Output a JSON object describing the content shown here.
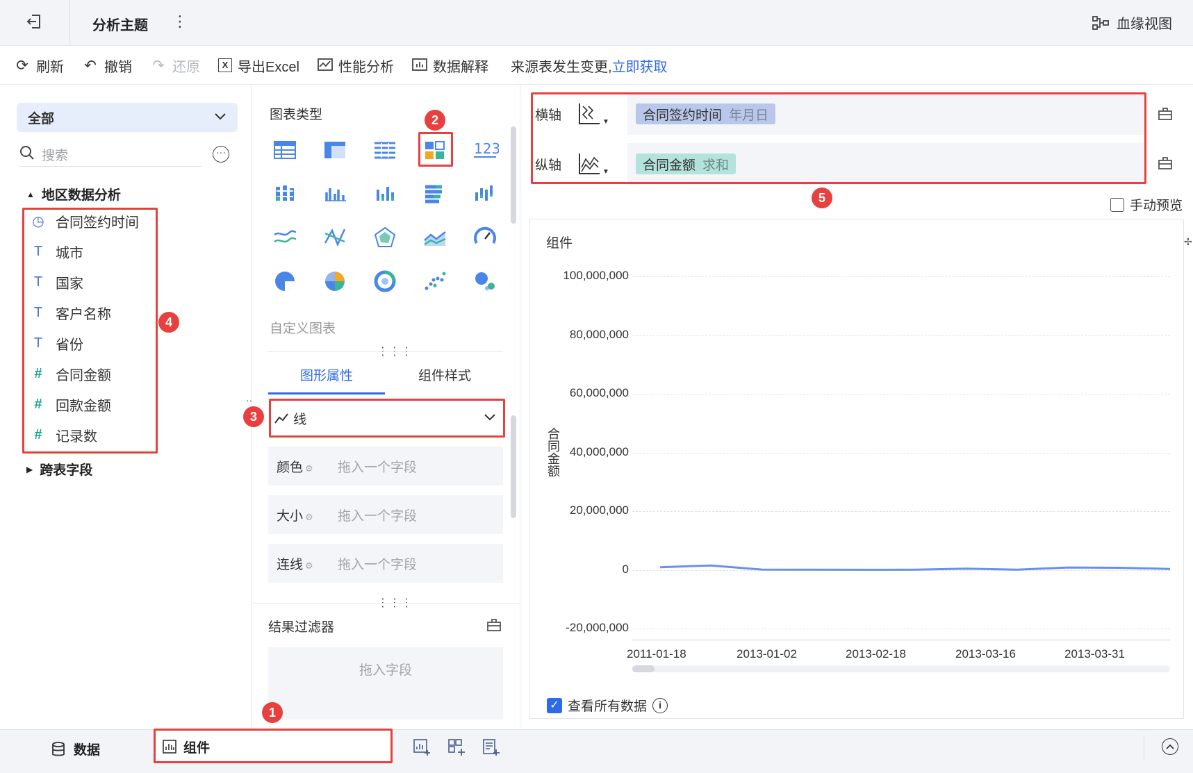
{
  "topbar": {
    "title": "分析主题",
    "lineage_label": "血缘视图"
  },
  "toolbar": {
    "refresh": "刷新",
    "undo": "撤销",
    "redo": "还原",
    "export_excel": "导出Excel",
    "perf_analysis": "性能分析",
    "data_explain": "数据解释",
    "notice_text": "来源表发生变更,",
    "notice_link": "立即获取"
  },
  "left": {
    "dropdown_value": "全部",
    "search_placeholder": "搜索",
    "group_label": "地区数据分析",
    "fields": [
      {
        "label": "合同签约时间",
        "icon": "clock-icon"
      },
      {
        "label": "城市",
        "icon": "text-icon"
      },
      {
        "label": "国家",
        "icon": "text-icon"
      },
      {
        "label": "客户名称",
        "icon": "text-icon"
      },
      {
        "label": "省份",
        "icon": "text-icon"
      },
      {
        "label": "合同金额",
        "icon": "hash-icon"
      },
      {
        "label": "回款金额",
        "icon": "hash-icon"
      },
      {
        "label": "记录数",
        "icon": "hash-icon"
      }
    ],
    "cross_table_label": "跨表字段"
  },
  "middle": {
    "chart_type_label": "图表类型",
    "custom_chart_label": "自定义图表",
    "tabs": [
      "图形属性",
      "组件样式"
    ],
    "mark_type": "线",
    "props": [
      {
        "label": "颜色",
        "placeholder": "拖入一个字段"
      },
      {
        "label": "大小",
        "placeholder": "拖入一个字段"
      },
      {
        "label": "连线",
        "placeholder": "拖入一个字段"
      }
    ],
    "filter_label": "结果过滤器",
    "filter_placeholder": "拖入字段"
  },
  "right": {
    "x_axis_label": "横轴",
    "x_field": "合同签约时间",
    "x_field_agg": "年月日",
    "y_axis_label": "纵轴",
    "y_field": "合同金额",
    "y_field_agg": "求和",
    "manual_preview": "手动预览",
    "view_all_data": "查看所有数据"
  },
  "bottom": {
    "data_tab": "数据",
    "component_tab": "组件"
  },
  "badges": [
    "1",
    "2",
    "3",
    "4",
    "5"
  ],
  "colors": {
    "accent": "#2e6be6",
    "annotation_red": "#e8403e",
    "x_pill": "#b9c7ea",
    "y_pill": "#b3e3dc",
    "line": "#6a8ff0"
  },
  "chart_data": {
    "type": "line",
    "title": "组件",
    "xlabel": "",
    "ylabel": "合同金额",
    "x_ticks": [
      "2011-01-18",
      "2013-01-02",
      "2013-02-18",
      "2013-03-16",
      "2013-03-31"
    ],
    "y_ticks": [
      "100,000,000",
      "80,000,000",
      "60,000,000",
      "40,000,000",
      "20,000,000",
      "0",
      "-20,000,000"
    ],
    "ylim": [
      -20000000,
      100000000
    ],
    "series": [
      {
        "values": [
          900000,
          1500000,
          100000,
          50000,
          30000,
          50000,
          400000,
          50000,
          800000,
          700000,
          300000
        ]
      }
    ],
    "grid": true
  }
}
